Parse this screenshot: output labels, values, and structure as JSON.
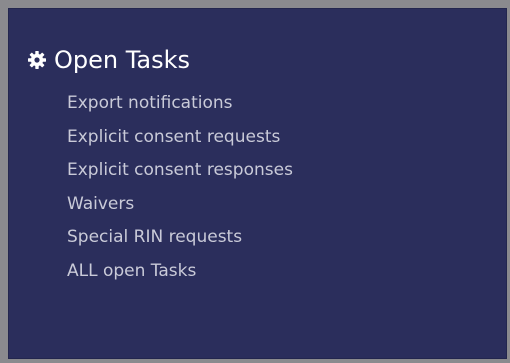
{
  "panel": {
    "title": "Open Tasks",
    "icon": "gear-icon",
    "background_color": "#2b2e5c",
    "title_color": "#ffffff",
    "link_color": "#c9cad8"
  },
  "tasks": [
    {
      "label": "Export notifications"
    },
    {
      "label": "Explicit consent requests"
    },
    {
      "label": "Explicit consent responses"
    },
    {
      "label": "Waivers"
    },
    {
      "label": "Special RIN requests"
    },
    {
      "label": "ALL open Tasks"
    }
  ]
}
